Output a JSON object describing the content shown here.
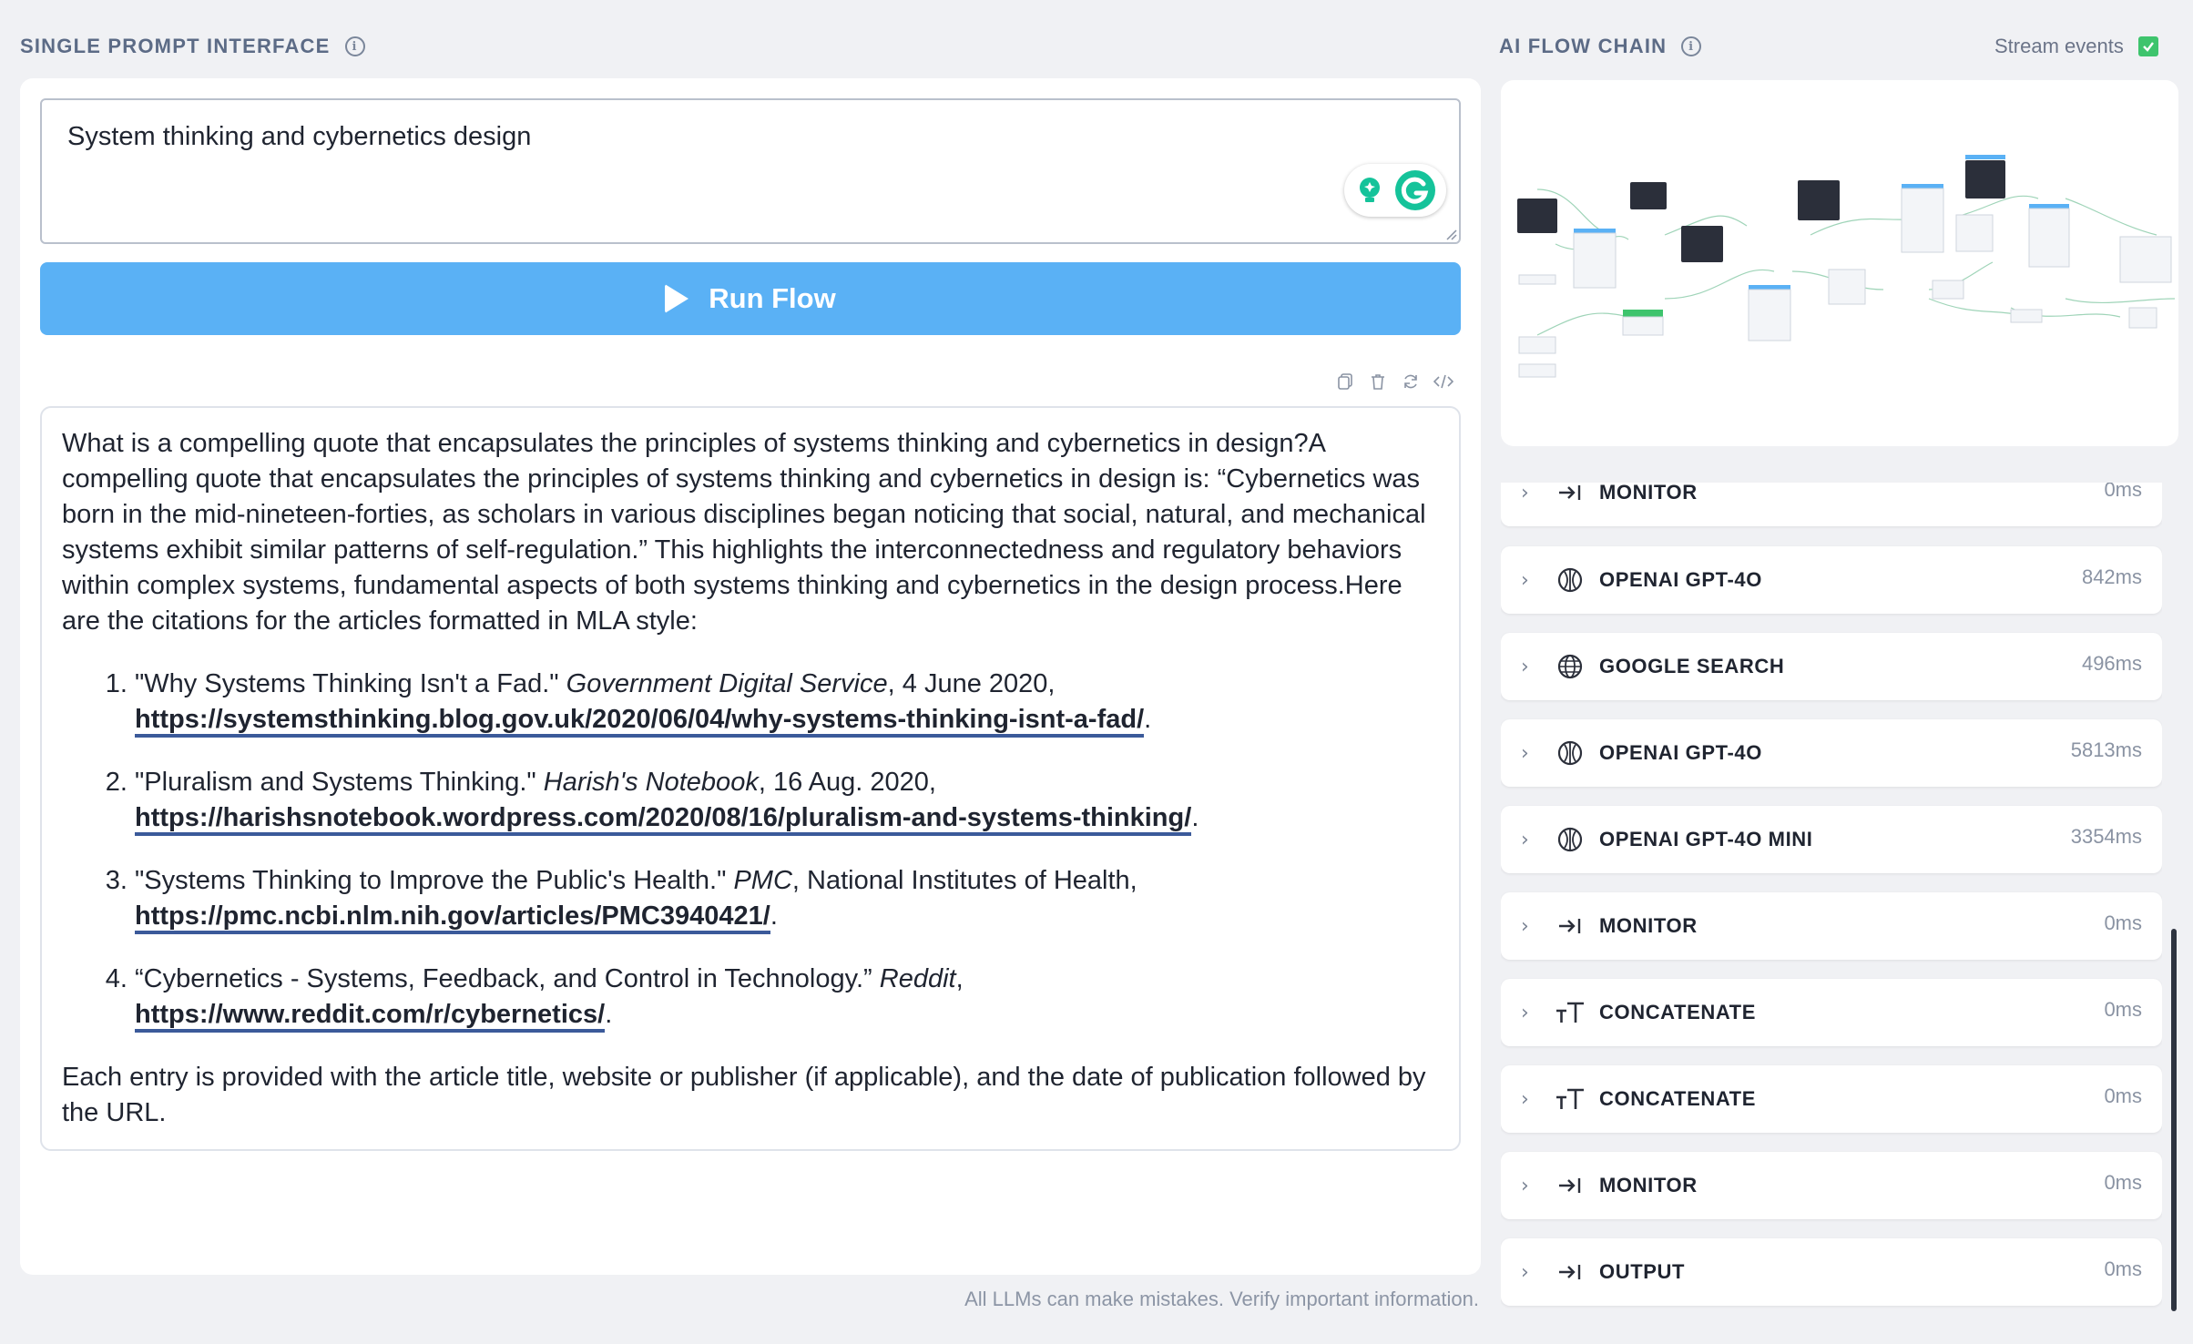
{
  "left": {
    "section_title": "SINGLE PROMPT INTERFACE",
    "prompt_value": "System thinking and cybernetics design",
    "run_label": "Run Flow",
    "response": {
      "intro": "What is a compelling quote that encapsulates the principles of systems thinking and cybernetics in design?A compelling quote that encapsulates the principles of systems thinking and cybernetics in design is: “Cybernetics was born in the mid-nineteen-forties, as scholars in various disciplines began noticing that social, natural, and mechanical systems exhibit similar patterns of self-regulation.” This highlights the interconnectedness and regulatory behaviors within complex systems, fundamental aspects of both systems thinking and cybernetics in the design process.Here are the citations for the articles formatted in MLA style:",
      "citations": [
        {
          "title": "\"Why Systems Thinking Isn't a Fad.\" ",
          "source": "Government Digital Service",
          "rest": ", 4 June 2020,",
          "url": "https://systemsthinking.blog.gov.uk/2020/06/04/why-systems-thinking-isnt-a-fad/"
        },
        {
          "title": "\"Pluralism and Systems Thinking.\" ",
          "source": "Harish's Notebook",
          "rest": ", 16 Aug. 2020,",
          "url": "https://harishsnotebook.wordpress.com/2020/08/16/pluralism-and-systems-thinking/"
        },
        {
          "title": "\"Systems Thinking to Improve the Public's Health.\" ",
          "source": "PMC",
          "rest": ", National Institutes of Health,",
          "url": "https://pmc.ncbi.nlm.nih.gov/articles/PMC3940421/"
        },
        {
          "title": "“Cybernetics - Systems, Feedback, and Control in Technology.” ",
          "source": "Reddit",
          "rest": ",",
          "url": "https://www.reddit.com/r/cybernetics/"
        }
      ],
      "outro": "Each entry is provided with the article title, website or publisher (if applicable), and the date of publication followed by the URL."
    },
    "disclaimer": "All LLMs can make mistakes. Verify important information."
  },
  "right": {
    "section_title": "AI FLOW CHAIN",
    "stream_label": "Stream events",
    "steps": [
      {
        "label": "MONITOR",
        "duration": "0ms",
        "icon": "monitor-icon"
      },
      {
        "label": "OPENAI GPT-4O",
        "duration": "842ms",
        "icon": "openai-icon"
      },
      {
        "label": "GOOGLE SEARCH",
        "duration": "496ms",
        "icon": "globe-icon"
      },
      {
        "label": "OPENAI GPT-4O",
        "duration": "5813ms",
        "icon": "openai-icon"
      },
      {
        "label": "OPENAI GPT-4O MINI",
        "duration": "3354ms",
        "icon": "openai-icon"
      },
      {
        "label": "MONITOR",
        "duration": "0ms",
        "icon": "monitor-icon"
      },
      {
        "label": "CONCATENATE",
        "duration": "0ms",
        "icon": "text-icon"
      },
      {
        "label": "CONCATENATE",
        "duration": "0ms",
        "icon": "text-icon"
      },
      {
        "label": "MONITOR",
        "duration": "0ms",
        "icon": "monitor-icon"
      },
      {
        "label": "OUTPUT",
        "duration": "0ms",
        "icon": "monitor-icon"
      }
    ]
  },
  "colors": {
    "accent": "#5ab1f5",
    "check": "#3ec46d",
    "header": "#5c6b86"
  }
}
